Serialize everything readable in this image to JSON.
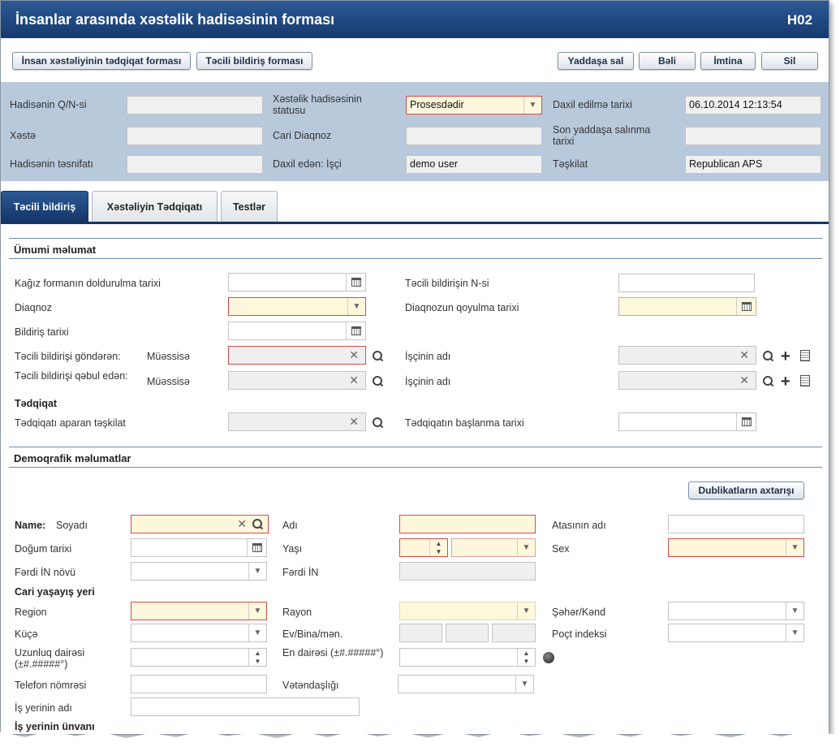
{
  "title": "İnsanlar arasında xəstəlik hadisəsinin forması",
  "code": "H02",
  "toolbar": {
    "btn_research": "İnsan xəstəliyinin tədqiqat forması",
    "btn_urgent": "Təcili bildiriş forması",
    "btn_save": "Yaddaşa sal",
    "btn_yes": "Bəli",
    "btn_cancel": "İmtina",
    "btn_delete": "Sil"
  },
  "header": {
    "case_no_label": "Hadisənin Q/N-si",
    "case_no_value": "",
    "status_label": "Xəstəlik hadisəsinin statusu",
    "status_value": "Prosesdədir",
    "entered_date_label": "Daxil edilmə tarixi",
    "entered_date_value": "06.10.2014 12:13:54",
    "patient_label": "Xəstə",
    "patient_value": "",
    "current_diag_label": "Cari Diaqnoz",
    "current_diag_value": "",
    "last_saved_label": "Son yaddaşa salınma tarixi",
    "last_saved_value": "",
    "classification_label": "Hadisənin təsnifatı",
    "classification_value": "",
    "entered_by_label": "Daxil edən: İşçi",
    "entered_by_value": "demo user",
    "organization_label": "Təşkilat",
    "organization_value": "Republican APS"
  },
  "tabs": [
    "Təcili bildiriş",
    "Xəstəliyin Tədqiqatı",
    "Testlər"
  ],
  "general": {
    "heading": "Ümumi məlumat",
    "paper_date_label": "Kağız formanın doldurulma tarixi",
    "notification_no_label": "Təcili bildirişin N-si",
    "diagnosis_label": "Diaqnoz",
    "diagnosis_date_label": "Diaqnozun qoyulma tarixi",
    "notification_date_label": "Bildiriş tarixi",
    "sent_by_label": "Təcili bildirişi göndərən:",
    "institution_label": "Müəssisə",
    "employee_label": "İşçinin adı",
    "received_by_label": "Təcili bildirişi qəbul edən:",
    "institution2_label": "Müəssisə",
    "employee2_label": "İşçinin adı",
    "investigation_label": "Tədqiqat",
    "investigating_org_label": "Tədqiqatı aparan təşkilat",
    "investigation_start_label": "Tədqiqatın başlanma tarixi"
  },
  "demo": {
    "heading": "Demoqrafik məlumatlar",
    "dup_search": "Dublikatların axtarışı",
    "name_label": "Name:",
    "surname_label": "Soyadı",
    "first_name_label": "Adı",
    "father_name_label": "Atasının adı",
    "dob_label": "Doğum tarixi",
    "age_label": "Yaşı",
    "sex_label": "Sex",
    "pin_type_label": "Fərdi İN növü",
    "pin_label": "Fərdi İN",
    "residence_label": "Cari yaşayış yeri",
    "region_label": "Region",
    "rayon_label": "Rayon",
    "city_label": "Şəhər/Kənd",
    "street_label": "Küçə",
    "building_label": "Ev/Bina/mən.",
    "postal_label": "Poçt indeksi",
    "longitude_label": "Uzunluq dairəsi (±#.#####°)",
    "latitude_label": "En dairəsi (±#.#####°)",
    "phone_label": "Telefon nömrəsi",
    "citizenship_label": "Vətəndaşlığı",
    "workplace_label": "İş yerinin adı",
    "workplace_addr_label": "İş yerinin ünvanı"
  }
}
